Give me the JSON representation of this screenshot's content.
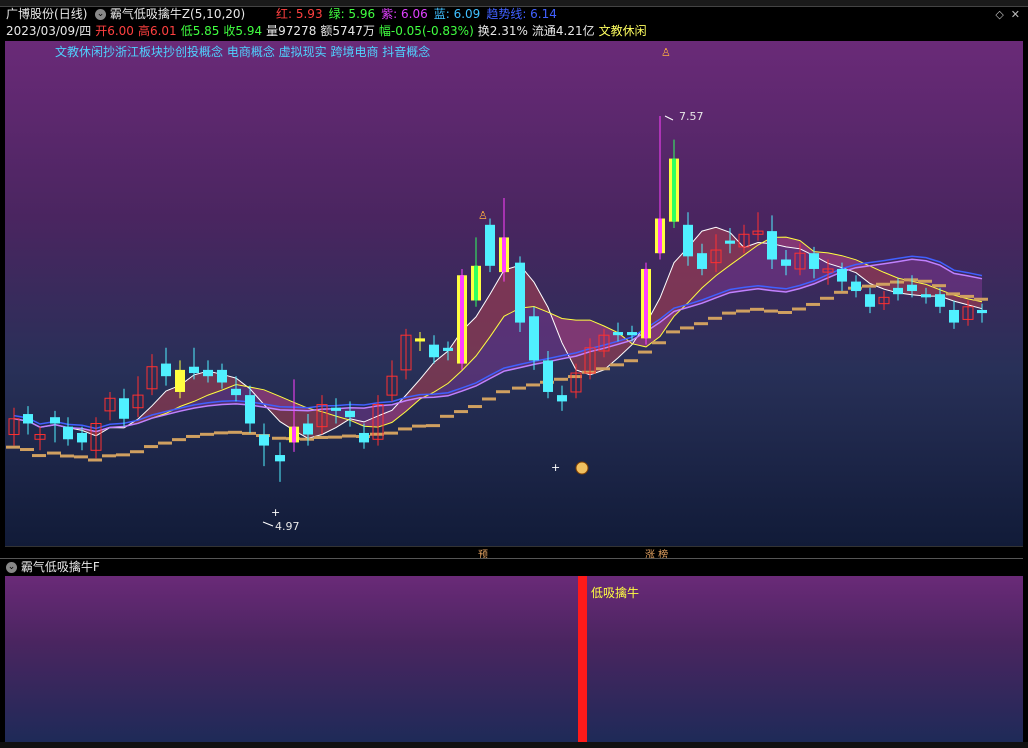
{
  "header": {
    "stock_name": "广博股份",
    "period": "(日线)",
    "indicator_main": "霸气低吸擒牛Z(5,10,20)",
    "legend": [
      {
        "label": "红: 5.93",
        "color": "#ff4040"
      },
      {
        "label": "绿: 5.96",
        "color": "#40ff40"
      },
      {
        "label": "紫: 6.06",
        "color": "#e040ff"
      },
      {
        "label": "蓝: 6.09",
        "color": "#40c0ff"
      },
      {
        "label": "趋势线: 6.14",
        "color": "#4060ff"
      }
    ],
    "quote": [
      {
        "label": "2023/03/09/四",
        "color": "#e8e8e8"
      },
      {
        "label": "开6.00",
        "color": "#ff4040"
      },
      {
        "label": "高6.01",
        "color": "#ff4040"
      },
      {
        "label": "低5.85",
        "color": "#40ff40"
      },
      {
        "label": "收5.94",
        "color": "#40ff40"
      },
      {
        "label": "量97278",
        "color": "#e8e8e8"
      },
      {
        "label": "额5747万",
        "color": "#e8e8e8"
      },
      {
        "label": "幅-0.05(-0.83%)",
        "color": "#40ff40"
      },
      {
        "label": "换2.31%",
        "color": "#e8e8e8"
      },
      {
        "label": "流通4.21亿",
        "color": "#e8e8e8"
      },
      {
        "label": "文教休闲",
        "color": "#ffff60"
      }
    ]
  },
  "concepts": "文教休闲抄浙江板块抄创投概念 电商概念 虚拟现实 跨境电商 抖音概念",
  "annotations": {
    "high": "7.57",
    "low": "4.97"
  },
  "axis_tags": [
    "预",
    "涨 榜"
  ],
  "sub_indicator": {
    "name": "霸气低吸擒牛F",
    "signal_label": "低吸擒牛"
  },
  "colors": {
    "up": "#ff3030",
    "down": "#50f0ff",
    "green_candle": "#30ff60",
    "magenta": "#ff40ff",
    "yellow": "#ffff40",
    "trend": "#d0a060"
  },
  "chart_data": {
    "type": "candlestick",
    "annotations_text": [
      "7.57",
      "4.97"
    ],
    "high_marker": 7.57,
    "low_marker": 4.97,
    "last_close": 5.94
  }
}
